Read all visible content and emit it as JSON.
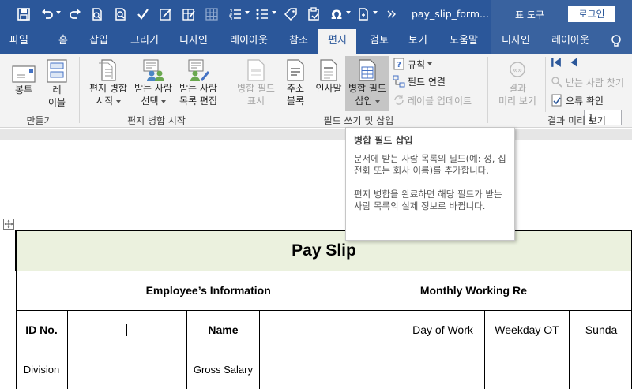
{
  "window": {
    "doc_title": "pay_slip_form...",
    "context_tools_label": "표 도구",
    "login_label": "로그인"
  },
  "tabs": [
    "파일",
    "홈",
    "삽입",
    "그리기",
    "디자인",
    "레이아웃",
    "참조",
    "편지",
    "검토",
    "보기",
    "도움말",
    "디자인",
    "레이아웃"
  ],
  "active_tab": "편지",
  "ribbon": {
    "create": {
      "envelope": "봉투",
      "labels_line1": "레",
      "labels_line2": "이블",
      "group": "만들기"
    },
    "start_merge": {
      "start_line1": "편지 병합",
      "start_line2": "시작",
      "select_line1": "받는 사람",
      "select_line2": "선택",
      "edit_line1": "받는 사람",
      "edit_line2": "목록 편집",
      "group": "편지 병합 시작"
    },
    "write_insert": {
      "highlight_line1": "병합 필드",
      "highlight_line2": "표시",
      "address_line1": "주소",
      "address_line2": "블록",
      "greeting": "인사말",
      "insert_line1": "병합 필드",
      "insert_line2": "삽입",
      "rules": "규칙",
      "match_fields": "필드 연결",
      "update_labels": "레이블 업데이트",
      "group": "필드 쓰기 및 삽입"
    },
    "preview": {
      "preview_line1": "결과",
      "preview_line2": "미리 보기",
      "record_value": "1",
      "find_recipient": "받는 사람 찾기",
      "check_errors": "오류 확인",
      "group": "결과 미리 보기"
    }
  },
  "tooltip": {
    "title": "병합 필드 삽입",
    "para1": "문서에 받는 사람 목록의 필드(예: 성, 집 전화 또는 회사 이름)를 추가합니다.",
    "para2": "편지 병합을 완료하면 해당 필드가 받는 사람 목록의 실제 정보로 바뀝니다."
  },
  "document": {
    "title": "Pay Slip",
    "section_employee": "Employee’s Information",
    "section_monthly": "Monthly Working Re",
    "row1": {
      "id_label": "ID No.",
      "name_label": "Name",
      "day_of_work": "Day of Work",
      "weekday_ot": "Weekday OT",
      "sunday": "Sunda"
    },
    "row2": {
      "division_label": "Division",
      "gross_salary_label": "Gross Salary"
    }
  }
}
